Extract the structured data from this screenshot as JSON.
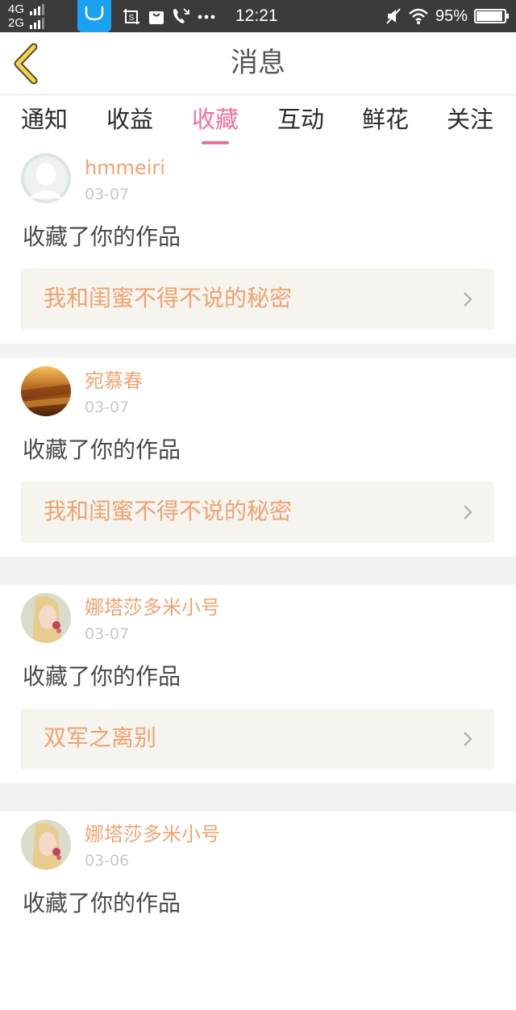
{
  "status_bar": {
    "network1": "4G",
    "network2": "2G",
    "time": "12:21",
    "battery": "95%",
    "battery_level": 0.95
  },
  "header": {
    "title": "消息",
    "back_icon": "back-chevron-icon"
  },
  "tabs": [
    {
      "label": "通知",
      "active": false
    },
    {
      "label": "收益",
      "active": false
    },
    {
      "label": "收藏",
      "active": true
    },
    {
      "label": "互动",
      "active": false
    },
    {
      "label": "鲜花",
      "active": false
    },
    {
      "label": "关注",
      "active": false
    }
  ],
  "items": [
    {
      "user": "hmmeiri",
      "date": "03-07",
      "action": "收藏了你的作品",
      "work": "我和闺蜜不得不说的秘密"
    },
    {
      "user": "宛慕春",
      "date": "03-07",
      "action": "收藏了你的作品",
      "work": "我和闺蜜不得不说的秘密"
    },
    {
      "user": "娜塔莎多米小号",
      "date": "03-07",
      "action": "收藏了你的作品",
      "work": "双军之离别"
    },
    {
      "user": "娜塔莎多米小号",
      "date": "03-06",
      "action": "收藏了你的作品",
      "work": ""
    }
  ],
  "colors": {
    "accent_pink": "#f06fa0",
    "accent_orange": "#f0a372",
    "status_bar_bg": "#3b3b3b",
    "page_bg": "#f2f2f2",
    "card_bg": "#ffffff",
    "work_bg": "#f5f4ee"
  }
}
